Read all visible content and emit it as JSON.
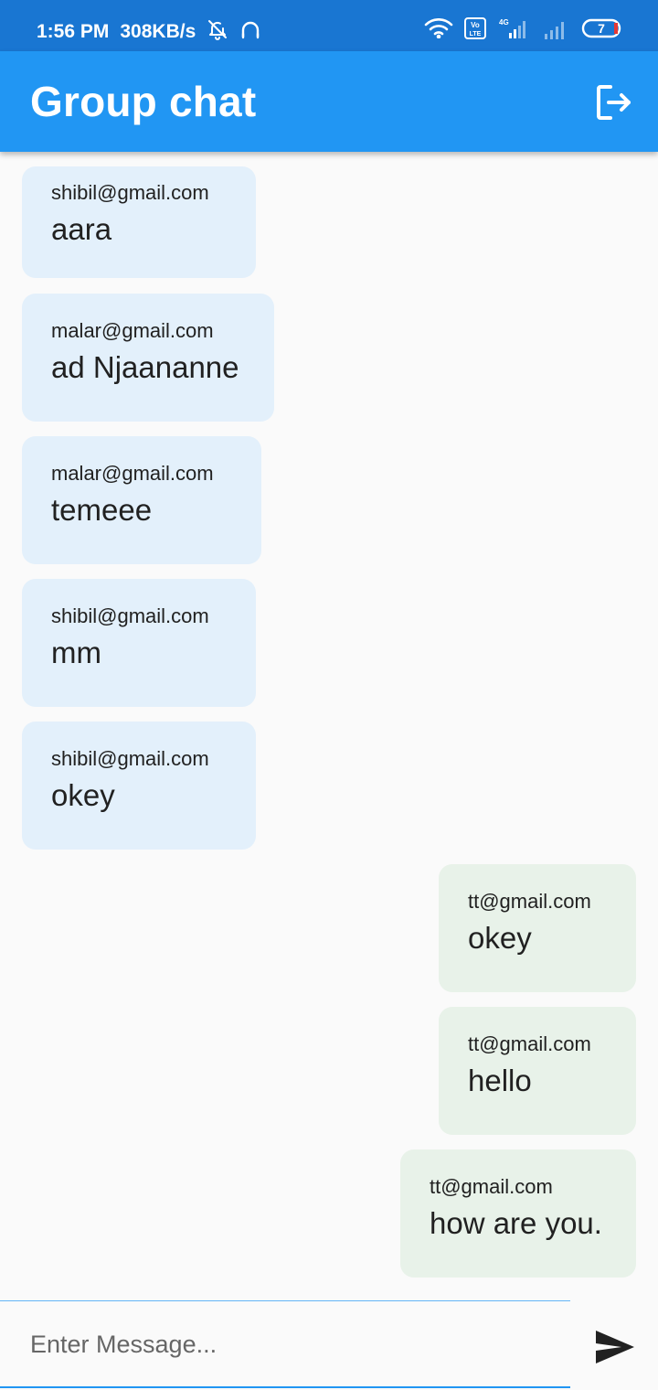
{
  "status_bar": {
    "time": "1:56 PM",
    "speed": "308KB/s",
    "battery": "7",
    "network": "4G",
    "volte": "Vo LTE"
  },
  "app_bar": {
    "title": "Group chat",
    "action_icon": "logout-icon"
  },
  "messages": [
    {
      "sender": "shibil@gmail.com",
      "text": "aara",
      "type": "received"
    },
    {
      "sender": "malar@gmail.com",
      "text": "ad Njaananne",
      "type": "received"
    },
    {
      "sender": "malar@gmail.com",
      "text": "temeee",
      "type": "received"
    },
    {
      "sender": "shibil@gmail.com",
      "text": "mm",
      "type": "received"
    },
    {
      "sender": "shibil@gmail.com",
      "text": "okey",
      "type": "received"
    },
    {
      "sender": "tt@gmail.com",
      "text": "okey",
      "type": "sent"
    },
    {
      "sender": "tt@gmail.com",
      "text": "hello",
      "type": "sent"
    },
    {
      "sender": "tt@gmail.com",
      "text": "how are you.",
      "type": "sent"
    }
  ],
  "composer": {
    "placeholder": "Enter Message...",
    "value": "",
    "send_icon": "send-icon"
  },
  "colors": {
    "status_bar": "#1976d2",
    "app_bar": "#2196f3",
    "received_bubble": "#e3f0fb",
    "sent_bubble": "#e8f2e9",
    "background": "#fafafa"
  }
}
